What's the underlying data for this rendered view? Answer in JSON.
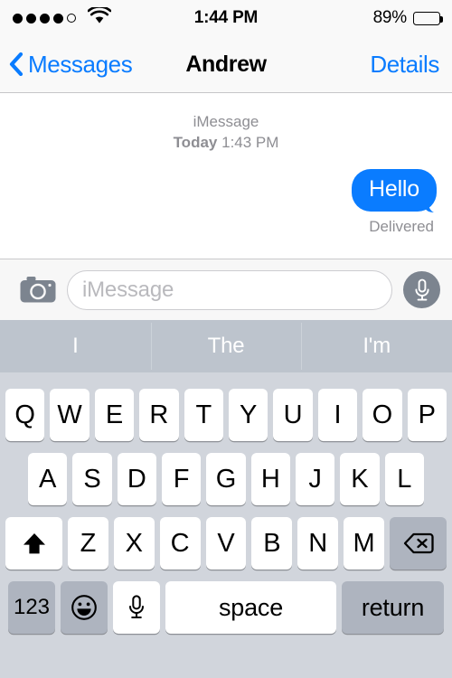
{
  "status_bar": {
    "signal_dots_total": 5,
    "signal_dots_filled": 4,
    "wifi_icon": "wifi-icon",
    "time": "1:44 PM",
    "battery_percent": "89%",
    "battery_level": 0.89
  },
  "nav_bar": {
    "back_icon": "chevron-left-icon",
    "back_label": "Messages",
    "title": "Andrew",
    "details_label": "Details",
    "accent_color": "#0a7cff"
  },
  "thread": {
    "service_label": "iMessage",
    "day_label": "Today",
    "time_label": "1:43 PM",
    "messages": [
      {
        "text": "Hello",
        "side": "outgoing",
        "bubble_color": "#0a7cff",
        "status": "Delivered"
      }
    ]
  },
  "input_bar": {
    "camera_icon": "camera-icon",
    "placeholder": "iMessage",
    "value": "",
    "mic_icon": "microphone-icon"
  },
  "predictive_bar": {
    "suggestions": [
      "I",
      "The",
      "I'm"
    ],
    "background_color": "#bdc4cd"
  },
  "keyboard": {
    "background_color": "#d1d5dc",
    "row1": [
      "Q",
      "W",
      "E",
      "R",
      "T",
      "Y",
      "U",
      "I",
      "O",
      "P"
    ],
    "row2": [
      "A",
      "S",
      "D",
      "F",
      "G",
      "H",
      "J",
      "K",
      "L"
    ],
    "row3_letters": [
      "Z",
      "X",
      "C",
      "V",
      "B",
      "N",
      "M"
    ],
    "shift_icon": "shift-up-arrow-icon",
    "backspace_icon": "backspace-delete-icon",
    "numeric_label": "123",
    "emoji_icon": "emoji-smiley-icon",
    "dictation_icon": "microphone-icon",
    "space_label": "space",
    "return_label": "return"
  }
}
